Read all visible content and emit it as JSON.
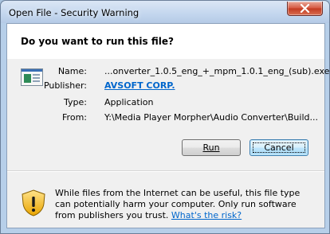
{
  "window": {
    "title": "Open File - Security Warning"
  },
  "question": "Do you want to run this file?",
  "file": {
    "name_label": "Name:",
    "name_value": "...onverter_1.0.5_eng_+_mpm_1.0.1_eng_(sub).exe",
    "publisher_label": "Publisher:",
    "publisher_value": "AVSOFT CORP.",
    "type_label": "Type:",
    "type_value": "Application",
    "from_label": "From:",
    "from_value": "Y:\\Media Player Morpher\\Audio Converter\\Build..."
  },
  "buttons": {
    "run": "Run",
    "cancel": "Cancel"
  },
  "warning": {
    "text": "While files from the Internet can be useful, this file type can potentially harm your computer. Only run software from publishers you trust.",
    "link": "What's the risk?"
  },
  "colors": {
    "link": "#0066cc",
    "titlebar": "#c3d6ee",
    "close_button": "#c23a20"
  }
}
